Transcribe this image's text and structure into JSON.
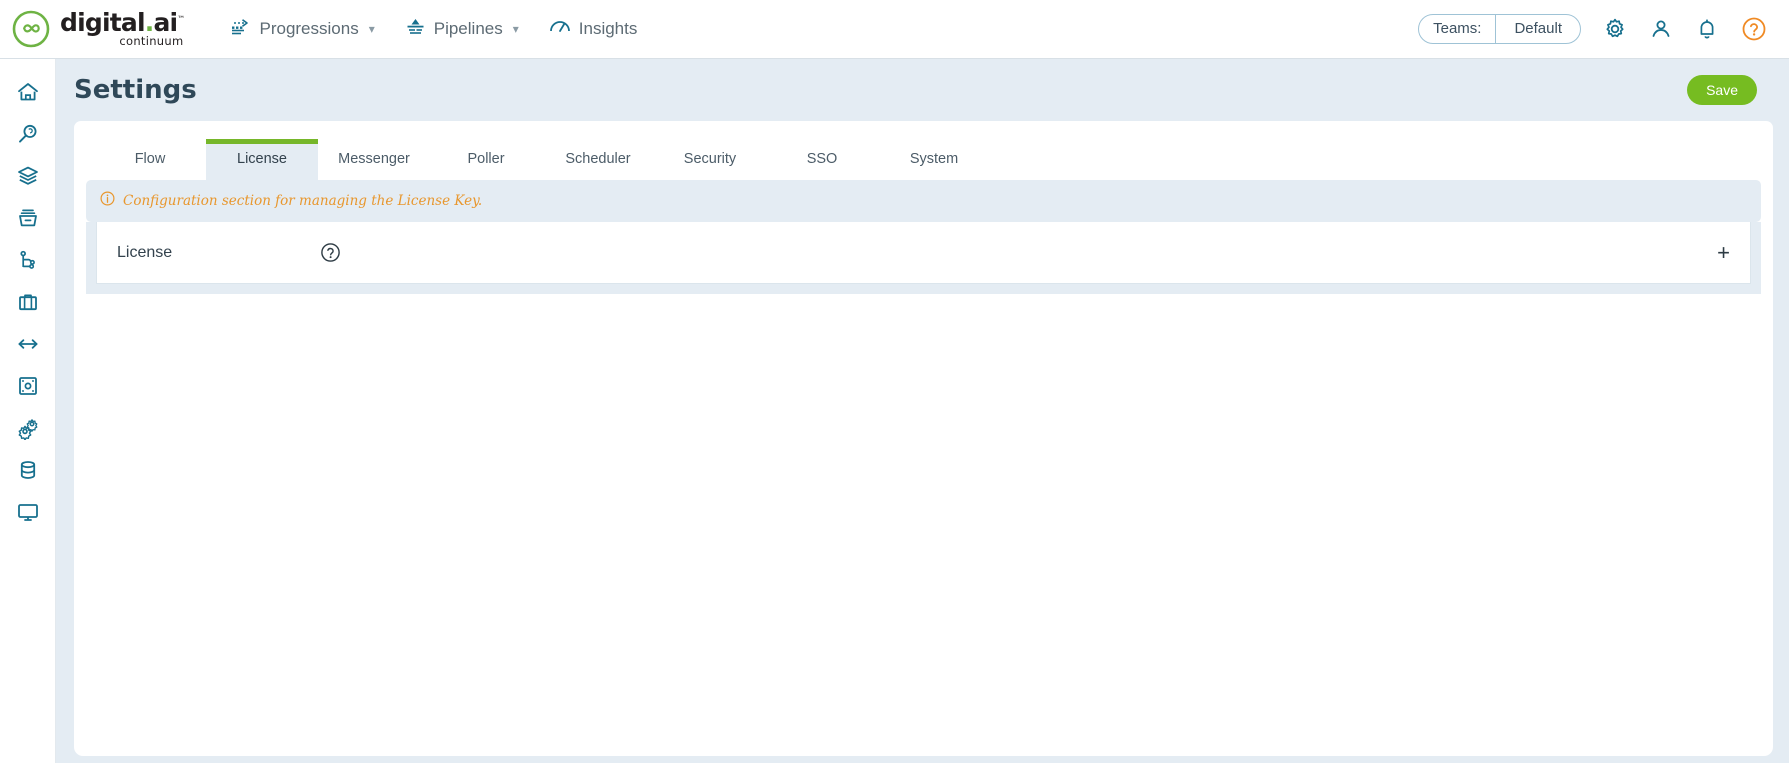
{
  "brand": {
    "name": "digital.ai",
    "sub": "continuum",
    "logo_icon": "infinity-logo-icon",
    "green": "#6eb344"
  },
  "topnav": {
    "items": [
      {
        "label": "Progressions",
        "icon": "progressions-icon",
        "has_caret": true
      },
      {
        "label": "Pipelines",
        "icon": "pipelines-icon",
        "has_caret": true
      },
      {
        "label": "Insights",
        "icon": "insights-icon",
        "has_caret": false
      }
    ],
    "teams": {
      "label": "Teams:",
      "value": "Default"
    },
    "icons": [
      {
        "name": "gear-icon"
      },
      {
        "name": "user-icon"
      },
      {
        "name": "bell-icon"
      },
      {
        "name": "help-circle-icon"
      }
    ]
  },
  "sidebar": {
    "items": [
      {
        "icon": "home-icon"
      },
      {
        "icon": "search-icon"
      },
      {
        "icon": "layers-icon"
      },
      {
        "icon": "archive-icon"
      },
      {
        "icon": "branch-icon"
      },
      {
        "icon": "briefcase-icon"
      },
      {
        "icon": "arrows-left-right-icon"
      },
      {
        "icon": "dashboard-grid-icon"
      },
      {
        "icon": "gears-icon"
      },
      {
        "icon": "database-icon"
      },
      {
        "icon": "monitor-icon"
      }
    ]
  },
  "page": {
    "title": "Settings",
    "save_label": "Save"
  },
  "tabs": [
    {
      "label": "Flow",
      "active": false
    },
    {
      "label": "License",
      "active": true
    },
    {
      "label": "Messenger",
      "active": false
    },
    {
      "label": "Poller",
      "active": false
    },
    {
      "label": "Scheduler",
      "active": false
    },
    {
      "label": "Security",
      "active": false
    },
    {
      "label": "SSO",
      "active": false
    },
    {
      "label": "System",
      "active": false
    }
  ],
  "banner": {
    "icon": "info-circle-icon",
    "text": "Configuration section for managing the License Key.",
    "color": "#e8972e"
  },
  "accordion": {
    "label": "License",
    "help_icon": "question-circle-icon",
    "expand_symbol": "+"
  },
  "colors": {
    "page_bg": "#e4ecf3",
    "accent_green": "#76bc21",
    "teal": "#17708e",
    "title": "#2f4858"
  }
}
